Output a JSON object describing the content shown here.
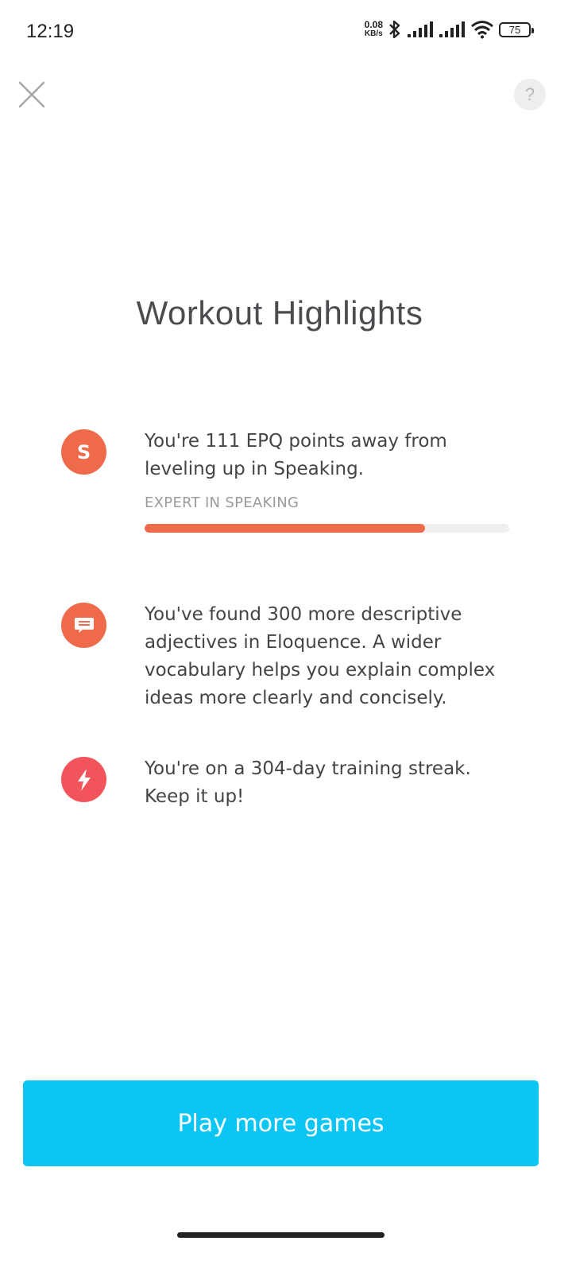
{
  "status_bar": {
    "time": "12:19",
    "net_speed_value": "0.08",
    "net_speed_unit": "KB/s",
    "battery": "75",
    "icons": [
      "bluetooth-icon",
      "signal-icon",
      "signal-icon",
      "wifi-icon",
      "battery-icon"
    ]
  },
  "header": {
    "close_icon": "close-icon",
    "help_label": "?"
  },
  "title": "Workout Highlights",
  "highlights": [
    {
      "icon": "s-badge-icon",
      "icon_letter": "S",
      "icon_color": "#ef6a4a",
      "text": "You're 111 EPQ points away from leveling up in Speaking.",
      "level_label": "EXPERT IN SPEAKING",
      "progress": 0.77
    },
    {
      "icon": "speech-bubble-icon",
      "icon_color": "#ef6a4a",
      "text": "You've found 300 more descriptive adjectives in Eloquence. A wider vocabulary helps you explain complex ideas more clearly and concisely."
    },
    {
      "icon": "lightning-icon",
      "icon_color": "#f2545b",
      "text": "You're on a 304-day training streak. Keep it up!"
    }
  ],
  "cta": {
    "label": "Play more games",
    "color": "#0bc6f5"
  }
}
